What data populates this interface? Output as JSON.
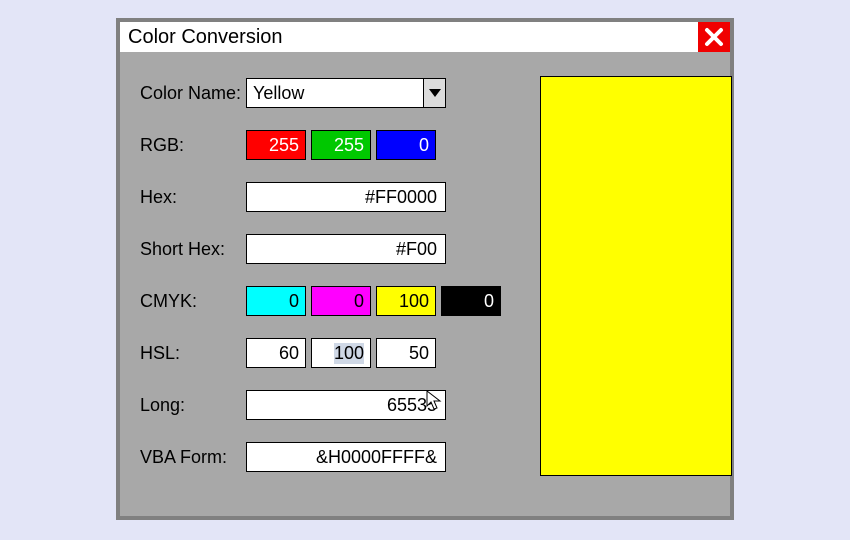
{
  "window": {
    "title": "Color Conversion",
    "close_icon": "close-icon"
  },
  "labels": {
    "color_name": "Color Name:",
    "rgb": "RGB:",
    "hex": "Hex:",
    "short_hex": "Short Hex:",
    "cmyk": "CMYK:",
    "hsl": "HSL:",
    "long": "Long:",
    "vba": "VBA Form:"
  },
  "color_name": {
    "selected": "Yellow"
  },
  "rgb": {
    "r": {
      "value": "255",
      "bg": "#ff0000",
      "fg": "#ffffff"
    },
    "g": {
      "value": "255",
      "bg": "#00c800",
      "fg": "#ffffff"
    },
    "b": {
      "value": "0",
      "bg": "#0000ff",
      "fg": "#ffffff"
    }
  },
  "hex": {
    "value": "#FF0000"
  },
  "short_hex": {
    "value": "#F00"
  },
  "cmyk": {
    "c": {
      "value": "0",
      "bg": "#00ffff",
      "fg": "#000000"
    },
    "m": {
      "value": "0",
      "bg": "#ff00ff",
      "fg": "#000000"
    },
    "y": {
      "value": "100",
      "bg": "#ffff00",
      "fg": "#000000"
    },
    "k": {
      "value": "0",
      "bg": "#000000",
      "fg": "#ffffff"
    }
  },
  "hsl": {
    "h": "60",
    "s": "100",
    "l": "50"
  },
  "long_val": {
    "value": "65535"
  },
  "vba": {
    "value": "&H0000FFFF&"
  },
  "preview_color": "#ffff00"
}
